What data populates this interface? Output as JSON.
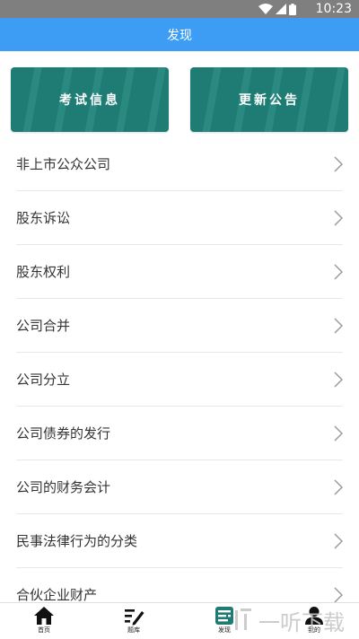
{
  "status_bar": {
    "time": "10:23"
  },
  "title_bar": {
    "title": "发现"
  },
  "cards": [
    {
      "label": "考试信息"
    },
    {
      "label": "更新公告"
    }
  ],
  "list_items": [
    {
      "label": "非上市公众公司"
    },
    {
      "label": "股东诉讼"
    },
    {
      "label": "股东权利"
    },
    {
      "label": "公司合并"
    },
    {
      "label": "公司分立"
    },
    {
      "label": "公司债券的发行"
    },
    {
      "label": "公司的财务会计"
    },
    {
      "label": "民事法律行为的分类"
    },
    {
      "label": "合伙企业财产"
    }
  ],
  "tab_bar": {
    "tabs": [
      {
        "label": "首页",
        "icon": "home-icon"
      },
      {
        "label": "题库",
        "icon": "edit-icon"
      },
      {
        "label": "发现",
        "icon": "discover-icon",
        "active": true
      },
      {
        "label": "我的",
        "icon": "person-icon"
      }
    ]
  },
  "watermark": {
    "text": "一听下载"
  },
  "colors": {
    "title_bar": "#3d9df5",
    "card": "#1f7c74",
    "status_bar": "#7f7f7f",
    "active_tab": "#1f7c74"
  }
}
